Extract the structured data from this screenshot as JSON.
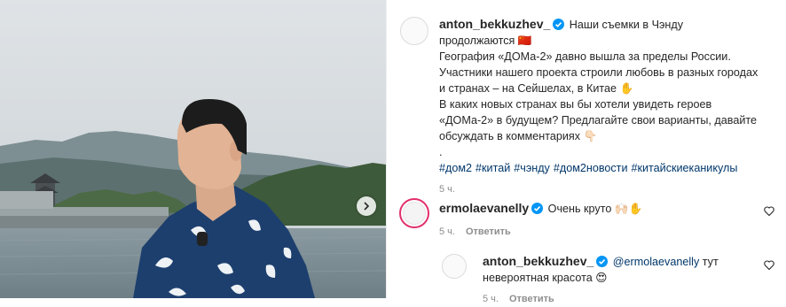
{
  "post": {
    "author": "anton_bekkuzhev_",
    "caption_first": "Наши съемки в Чэнду",
    "caption_lines": [
      "продолжаются 🇨🇳",
      "География «ДОМа-2» давно вышла за пределы России.",
      "Участники нашего проекта строили любовь в разных городах",
      "и странах – на Сейшелах, в Китае ✋",
      "В каких новых странах вы бы хотели увидеть героев",
      "«ДОМа-2» в будущем? Предлагайте свои варианты, давайте",
      "обсуждать в комментариях 👇🏻",
      "."
    ],
    "hashtags": [
      "#дом2",
      "#китай",
      "#чэнду",
      "#дом2новости",
      "#китайскиеканикулы"
    ],
    "time": "5 ч."
  },
  "comments": [
    {
      "author": "ermolaevanelly",
      "text": "Очень круто 🙌🏻✋",
      "time": "5 ч.",
      "reply_label": "Ответить"
    },
    {
      "author": "anton_bekkuzhev_",
      "mention": "@ermolaevanelly",
      "text_after": " тут",
      "text_line2": "невероятная красота 😍",
      "time": "5 ч.",
      "reply_label": "Ответить"
    }
  ],
  "colors": {
    "link": "#00376b",
    "verified": "#0095f6",
    "muted": "#8e8e8e",
    "story_ring": "#e1306c"
  }
}
